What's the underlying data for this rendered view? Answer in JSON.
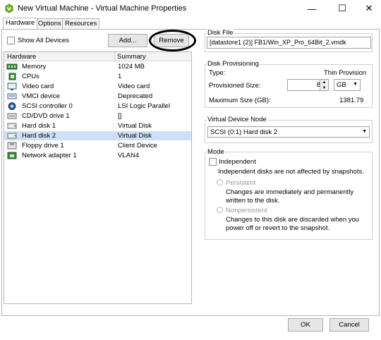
{
  "window": {
    "title": "New Virtual Machine - Virtual Machine Properties",
    "minimize_glyph": "—",
    "maximize_glyph": "☐",
    "close_glyph": "✕"
  },
  "tabs": [
    {
      "label": "Hardware",
      "active": true
    },
    {
      "label": "Options",
      "active": false
    },
    {
      "label": "Resources",
      "active": false
    }
  ],
  "toolbar": {
    "show_all_label": "Show All Devices",
    "show_all_checked": false,
    "add_label": "Add...",
    "remove_label": "Remove"
  },
  "hardware_table": {
    "col_hardware": "Hardware",
    "col_summary": "Summary",
    "rows": [
      {
        "name": "Memory",
        "summary": "1024 MB",
        "icon": "memory-icon",
        "selected": false
      },
      {
        "name": "CPUs",
        "summary": "1",
        "icon": "cpu-icon",
        "selected": false
      },
      {
        "name": "Video card",
        "summary": "Video card",
        "icon": "video-card-icon",
        "selected": false
      },
      {
        "name": "VMCI device",
        "summary": "Deprecated",
        "icon": "vmci-device-icon",
        "selected": false
      },
      {
        "name": "SCSI controller 0",
        "summary": "LSI Logic Parallel",
        "icon": "scsi-controller-icon",
        "selected": false
      },
      {
        "name": "CD/DVD drive 1",
        "summary": "[]",
        "icon": "cd-dvd-drive-icon",
        "selected": false
      },
      {
        "name": "Hard disk 1",
        "summary": "Virtual Disk",
        "icon": "hard-disk-icon",
        "selected": false
      },
      {
        "name": "Hard disk 2",
        "summary": "Virtual Disk",
        "icon": "hard-disk-icon",
        "selected": true
      },
      {
        "name": "Floppy drive 1",
        "summary": "Client Device",
        "icon": "floppy-drive-icon",
        "selected": false
      },
      {
        "name": "Network adapter 1",
        "summary": "VLAN4",
        "icon": "network-adapter-icon",
        "selected": false
      }
    ]
  },
  "disk_file": {
    "label": "Disk File",
    "value": "[datastore1 (2)] FB1/Win_XP_Pro_64Bit_2.vmdk"
  },
  "disk_provisioning": {
    "label": "Disk Provisioning",
    "type_label": "Type:",
    "type_value": "Thin Provision",
    "provisioned_size_label": "Provisioned Size:",
    "provisioned_size_value": "8",
    "unit_value": "GB",
    "max_size_label": "Maximum Size (GB):",
    "max_size_value": "1381.79"
  },
  "virtual_device_node": {
    "label": "Virtual Device Node",
    "value": "SCSI (0:1) Hard disk 2"
  },
  "mode": {
    "label": "Mode",
    "independent_label": "Independent",
    "independent_checked": false,
    "independent_desc": "Independent disks are not affected by snapshots.",
    "persistent_label": "Persistent",
    "persistent_desc": "Changes are immediately and permanently written to the disk.",
    "nonpersistent_label": "Nonpersistent",
    "nonpersistent_desc": "Changes to this disk are discarded when you power off or revert to the snapshot."
  },
  "footer": {
    "ok_label": "OK",
    "cancel_label": "Cancel"
  },
  "colors": {
    "selection": "#cde0f7",
    "app_icon": "#7ab829",
    "disabled_text": "#9a9a9a"
  }
}
